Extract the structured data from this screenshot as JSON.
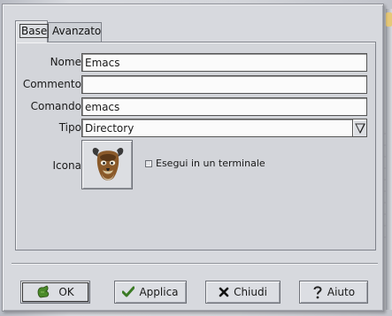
{
  "tabs": [
    {
      "label": "Base",
      "active": true
    },
    {
      "label": "Avanzato",
      "active": false
    }
  ],
  "form": {
    "nome": {
      "label": "Nome:",
      "value": "Emacs"
    },
    "commento": {
      "label": "Commento:",
      "value": ""
    },
    "comando": {
      "label": "Comando:",
      "value": "emacs"
    },
    "tipo": {
      "label": "Tipo:",
      "value": "Directory"
    },
    "icona": {
      "label": "Icona:",
      "icon": "gnu-head-icon"
    },
    "terminal": {
      "label": "Esegui in un terminale",
      "checked": false
    }
  },
  "buttons": {
    "ok": "OK",
    "applica": "Applica",
    "chiudi": "Chiudi",
    "aiuto": "Aiuto"
  },
  "colors": {
    "window_bg": "#d7d9de",
    "ok_icon": "#4a8a2a",
    "check_icon": "#3a7a24"
  }
}
